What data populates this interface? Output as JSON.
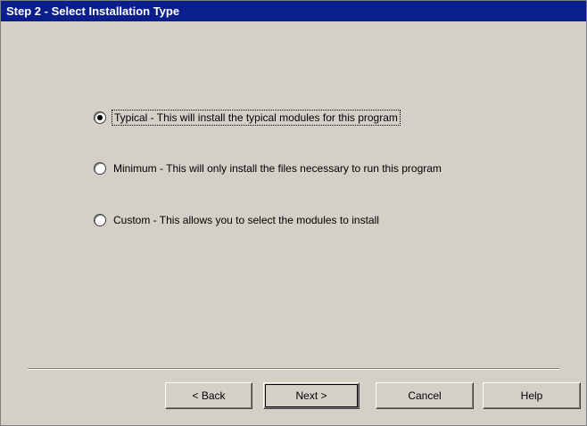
{
  "window": {
    "title": "Step 2 - Select Installation Type"
  },
  "options": [
    {
      "label": "Typical - This will install the typical modules for this program",
      "checked": true
    },
    {
      "label": "Minimum - This will only install the files necessary to run this program",
      "checked": false
    },
    {
      "label": "Custom - This allows you to select the modules to install",
      "checked": false
    }
  ],
  "buttons": {
    "back": "< Back",
    "next": "Next >",
    "cancel": "Cancel",
    "help": "Help"
  }
}
